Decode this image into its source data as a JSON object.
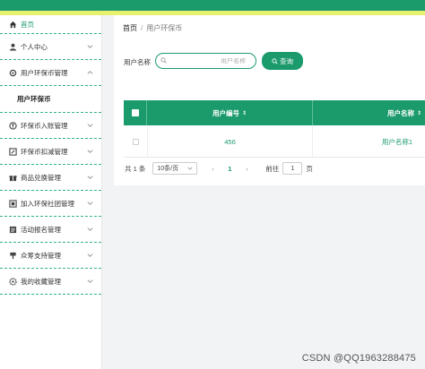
{
  "sidebar": {
    "home_label": "首页",
    "items": [
      {
        "label": "个人中心",
        "icon": "user-icon"
      },
      {
        "label": "用户环保币管理",
        "icon": "gear-icon"
      },
      {
        "label": "环保币入账管理",
        "icon": "coin-icon"
      },
      {
        "label": "环保币扣减管理",
        "icon": "edit-icon"
      },
      {
        "label": "商品兑换管理",
        "icon": "gift-icon"
      },
      {
        "label": "加入环保社团管理",
        "icon": "group-icon"
      },
      {
        "label": "活动报名管理",
        "icon": "list-icon"
      },
      {
        "label": "众筹支持管理",
        "icon": "flag-icon"
      },
      {
        "label": "我的收藏管理",
        "icon": "settings-icon"
      }
    ],
    "active_sub": "用户环保币"
  },
  "breadcrumb": {
    "home": "首页",
    "separator": "/",
    "current": "用户环保币"
  },
  "search": {
    "label": "用户名称",
    "placeholder": "用户名称",
    "button": "查询"
  },
  "table": {
    "headers": {
      "num": "用户编号",
      "name": "用户名称"
    },
    "rows": [
      {
        "num": "456",
        "name": "用户名称1"
      }
    ]
  },
  "pager": {
    "total": "共 1 条",
    "size": "10条/页",
    "page": "1",
    "goto_label": "前往",
    "goto_value": "1",
    "goto_suffix": "页"
  },
  "watermark": "CSDN @QQ1963288475",
  "colors": {
    "accent": "#1b9a6c",
    "topbar_stripe": "#e8f070"
  }
}
